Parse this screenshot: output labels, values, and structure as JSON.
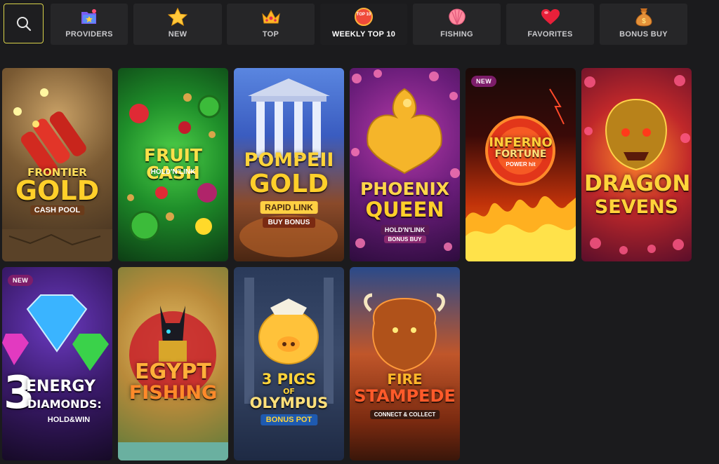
{
  "search": {
    "icon": "search-icon"
  },
  "tabs": [
    {
      "label": "PROVIDERS",
      "icon": "providers-icon"
    },
    {
      "label": "NEW",
      "icon": "star-icon"
    },
    {
      "label": "TOP",
      "icon": "crown-icon"
    },
    {
      "label": "WEEKLY TOP 10",
      "icon": "top10-icon",
      "icon_text": "TOP 10",
      "active": true
    },
    {
      "label": "FISHING",
      "icon": "shell-icon"
    },
    {
      "label": "FAVORITES",
      "icon": "heart-icon"
    },
    {
      "label": "BONUS BUY",
      "icon": "money-bag-icon"
    }
  ],
  "games": [
    {
      "title_1": "FRONTIER",
      "title_2": "GOLD",
      "sub": "CASH POOL",
      "badge": ""
    },
    {
      "title_1": "FRUIT CASH",
      "title_2": "",
      "sub": "HOLD'N'LINK",
      "badge": ""
    },
    {
      "title_1": "POMPEII",
      "title_2": "GOLD",
      "sub": "RAPID LINK",
      "sub_2": "BUY BONUS",
      "badge": ""
    },
    {
      "title_1": "PHOENIX",
      "title_2": "QUEEN",
      "sub": "HOLD'N'LINK",
      "sub_2": "BONUS BUY",
      "badge": ""
    },
    {
      "title_1": "INFERNO",
      "title_2": "FORTUNE",
      "sub": "POWER hit",
      "badge": "NEW"
    },
    {
      "title_1": "DRAGON",
      "title_2": "SEVENS",
      "sub": "",
      "badge": ""
    },
    {
      "title_1": "3",
      "title_2": "ENERGY",
      "title_3": "DIAMONDS:",
      "sub": "HOLD&WIN",
      "badge": "NEW"
    },
    {
      "title_1": "EGYPT",
      "title_2": "FISHING",
      "sub": "",
      "badge": ""
    },
    {
      "title_1": "3 PIGS",
      "title_2": "OF",
      "title_3": "OLYMPUS",
      "sub": "BONUS POT",
      "badge": ""
    },
    {
      "title_1": "FIRE",
      "title_2": "STAMPEDE",
      "sub": "CONNECT & COLLECT",
      "badge": ""
    }
  ],
  "colors": {
    "accent": "#d9d24a",
    "badge": "#7d1d6a",
    "background": "#1b1b1d"
  }
}
